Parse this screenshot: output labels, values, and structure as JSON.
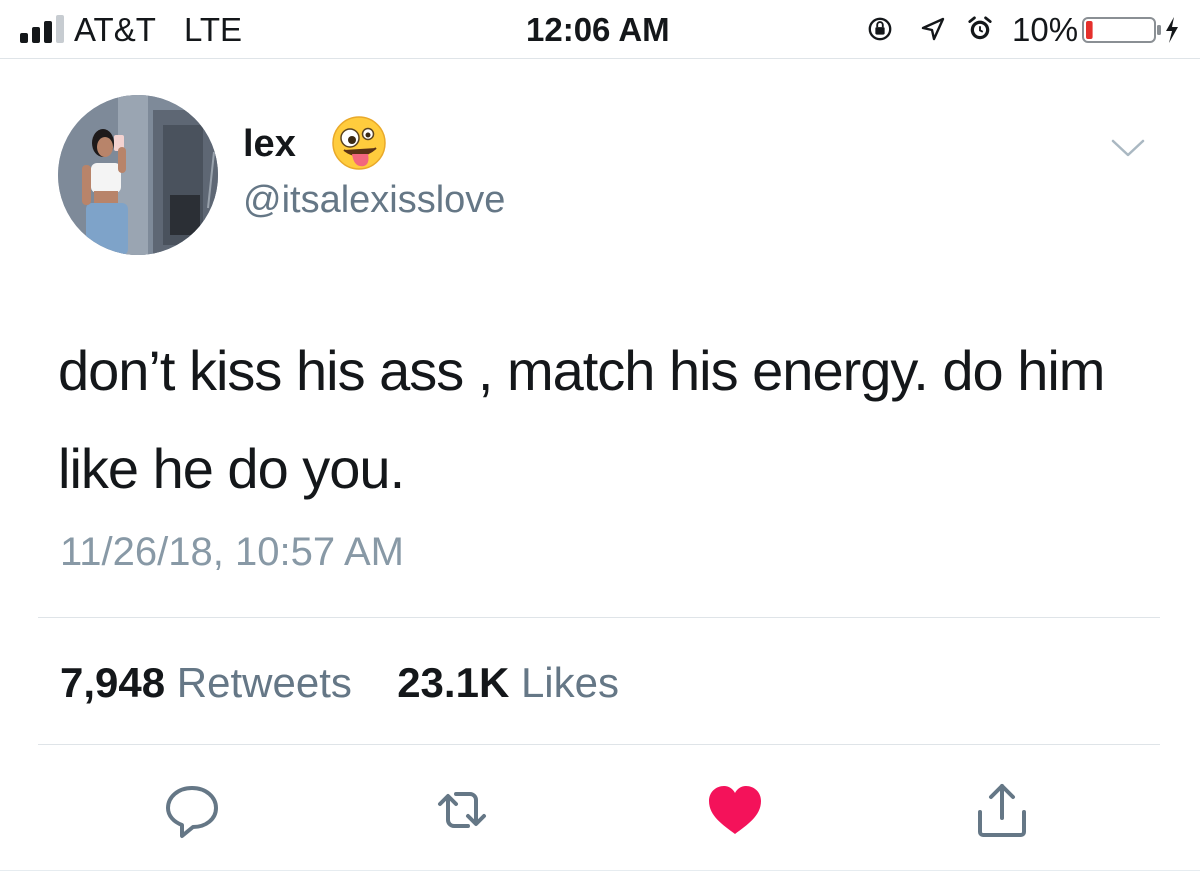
{
  "status_bar": {
    "carrier": "AT&T",
    "network": "LTE",
    "time": "12:06 AM",
    "battery_percent": "10%",
    "battery_level": 0.1,
    "icons": [
      "signal-icon",
      "orientation-lock-icon",
      "location-arrow-icon",
      "alarm-icon",
      "battery-icon",
      "charging-bolt-icon"
    ]
  },
  "tweet": {
    "display_name": "lex",
    "name_emoji": "zany-face-emoji",
    "handle": "@itsalexisslove",
    "text": "don’t kiss his ass , match his energy. do him like he do you.",
    "timestamp": "11/26/18, 10:57 AM",
    "stats": {
      "retweets_count": "7,948",
      "retweets_label": "Retweets",
      "likes_count": "23.1K",
      "likes_label": "Likes"
    },
    "actions": [
      "reply-icon",
      "retweet-icon",
      "like-icon",
      "share-icon"
    ],
    "liked": true
  },
  "colors": {
    "text_primary": "#14171a",
    "text_secondary": "#657786",
    "timestamp": "#8899a6",
    "divider": "#dfe4e8",
    "like_active": "#f4125a",
    "battery_low": "#e5302c",
    "icon_gray": "#657786"
  }
}
